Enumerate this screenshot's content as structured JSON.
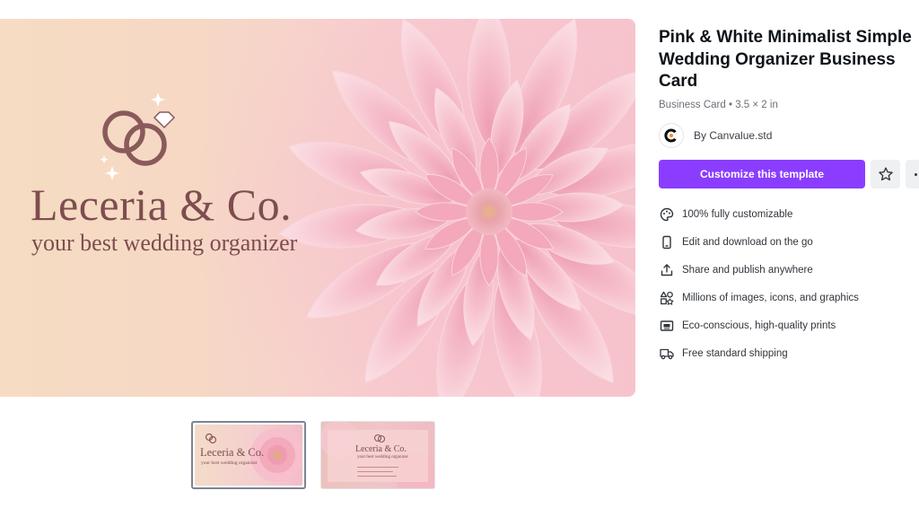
{
  "preview": {
    "brand_name": "Leceria & Co.",
    "tagline": "your best wedding organizer"
  },
  "thumbnails": [
    {
      "title": "Leceria & Co.",
      "subtitle": "your best wedding organizer",
      "selected": true
    },
    {
      "title": "Leceria & Co.",
      "subtitle": "your best wedding organizer",
      "selected": false
    }
  ],
  "template": {
    "title": "Pink & White Minimalist Simple Wedding Organizer Business Card",
    "meta": "Business Card • 3.5 × 2 in",
    "author": "By Canvalue.std"
  },
  "actions": {
    "customize_label": "Customize this template"
  },
  "features": [
    {
      "icon": "palette-icon",
      "label": "100% fully customizable"
    },
    {
      "icon": "mobile-phone-icon",
      "label": "Edit and download on the go"
    },
    {
      "icon": "share-icon",
      "label": "Share and publish anywhere"
    },
    {
      "icon": "shapes-icon",
      "label": "Millions of images, icons, and graphics"
    },
    {
      "icon": "print-icon",
      "label": "Eco-conscious, high-quality prints"
    },
    {
      "icon": "truck-icon",
      "label": "Free standard shipping"
    }
  ],
  "colors": {
    "accent": "#8b3dff",
    "brand_text": "#7d4d4f",
    "petal": "#f5b8c6"
  }
}
